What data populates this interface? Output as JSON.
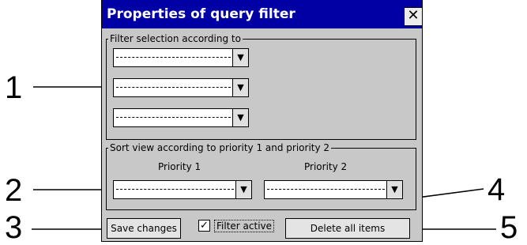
{
  "dialog": {
    "title": "Properties of query filter",
    "close_glyph": "✕",
    "filter_group": {
      "legend": "Filter selection according to"
    },
    "sort_group": {
      "legend": "Sort view according to priority 1 and priority 2",
      "priority1_label": "Priority 1",
      "priority2_label": "Priority 2"
    },
    "dropdown_glyph": "▼",
    "save_button": "Save changes",
    "filter_active": {
      "label": "Filter active",
      "checked": true,
      "check_glyph": "✓"
    },
    "delete_button": "Delete all items"
  },
  "callouts": {
    "c1": "1",
    "c2": "2",
    "c3": "3",
    "c4": "4",
    "c5": "5"
  },
  "colors": {
    "titlebar": "#0000a5",
    "dialog_bg": "#c8c8c8"
  }
}
